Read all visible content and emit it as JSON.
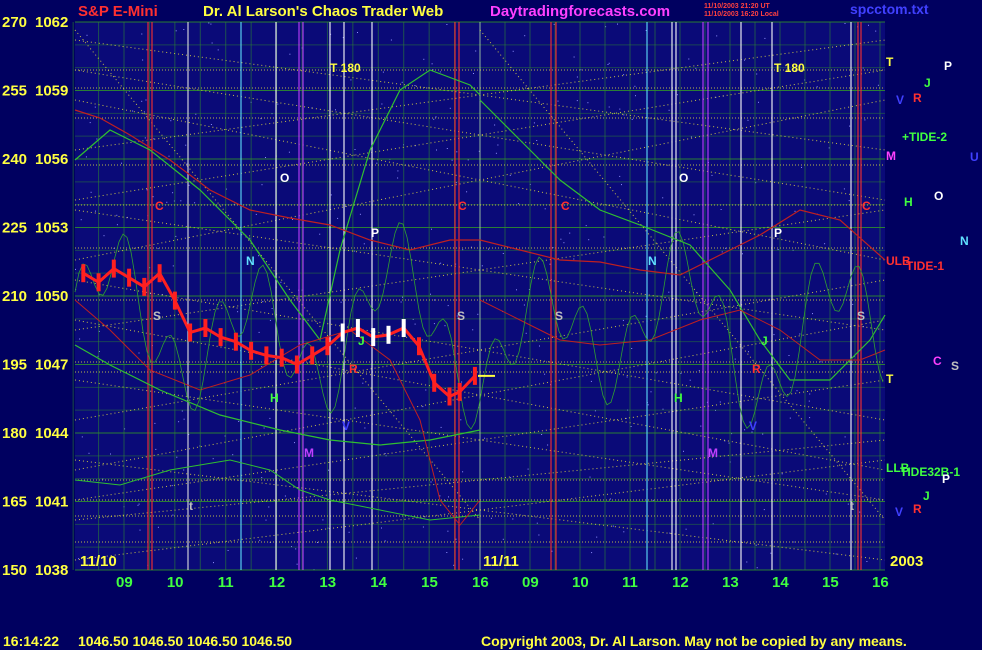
{
  "header": {
    "instrument": "S&P E-Mini",
    "site_title": "Dr. Al Larson's Chaos Trader Web",
    "site_url": "Daytradingforecasts.com",
    "timestamp_ut": "11/10/2003 21:20 UT",
    "timestamp_local": "11/10/2003 16:20 Local",
    "file": "spcctom.txt"
  },
  "footer": {
    "time": "16:14:22",
    "ohlc": "1046.50 1046.50 1046.50 1046.50",
    "copyright": "Copyright 2003, Dr. Al Larson. May not be copied by any means."
  },
  "colors": {
    "background": "#000060",
    "grid": "#2e8b2e",
    "price_candles": "#ff2020",
    "price_highlight": "#ffffff",
    "cycle_line": "#30c030",
    "moon_line": "#c02020",
    "dotted_lines": "#e8e040"
  },
  "chart_data": {
    "type": "line",
    "title": "S&P E-Mini",
    "y_left_labels": [
      "270",
      "255",
      "240",
      "225",
      "210",
      "195",
      "180",
      "165",
      "150"
    ],
    "y_right_labels": [
      "1062",
      "1059",
      "1056",
      "1053",
      "1050",
      "1047",
      "1044",
      "1041",
      "1038"
    ],
    "ylim": [
      1038,
      1062
    ],
    "date_labels": [
      "11/10",
      "11/11"
    ],
    "year_label": "2003",
    "x_hours_day1": [
      "09",
      "10",
      "11",
      "12",
      "13",
      "14",
      "15",
      "16"
    ],
    "x_hours_day2": [
      "09",
      "10",
      "11",
      "12",
      "13",
      "14",
      "15",
      "16"
    ],
    "series": [
      {
        "name": "price",
        "x": [
          8.2,
          8.5,
          8.8,
          9.1,
          9.4,
          9.7,
          10.0,
          10.3,
          10.6,
          10.9,
          11.2,
          11.5,
          11.8,
          12.1,
          12.4,
          12.7,
          13.0,
          13.3,
          13.6,
          13.9,
          14.2,
          14.5,
          14.8,
          15.1,
          15.4,
          15.6,
          15.9
        ],
        "values": [
          1051.0,
          1050.6,
          1051.2,
          1050.8,
          1050.4,
          1051.0,
          1049.8,
          1048.4,
          1048.6,
          1048.2,
          1048.0,
          1047.6,
          1047.4,
          1047.3,
          1047.0,
          1047.4,
          1047.8,
          1048.4,
          1048.6,
          1048.2,
          1048.3,
          1048.6,
          1047.8,
          1046.2,
          1045.6,
          1045.8,
          1046.5
        ]
      }
    ],
    "annotations": {
      "left_labels": [
        "C",
        "S",
        "N",
        "O",
        "H",
        "M",
        "J",
        "V",
        "P",
        "R",
        "t",
        "T 180"
      ],
      "right_panel": [
        "T",
        "J",
        "P",
        "R",
        "V",
        "+TIDE-2",
        "M",
        "U",
        "H",
        "O",
        "N",
        "ULB",
        "TIDE-1",
        "C",
        "S",
        "T",
        "LLB",
        "TIDE32B-1",
        "P",
        "J",
        "R",
        "V"
      ]
    },
    "grid": true
  }
}
